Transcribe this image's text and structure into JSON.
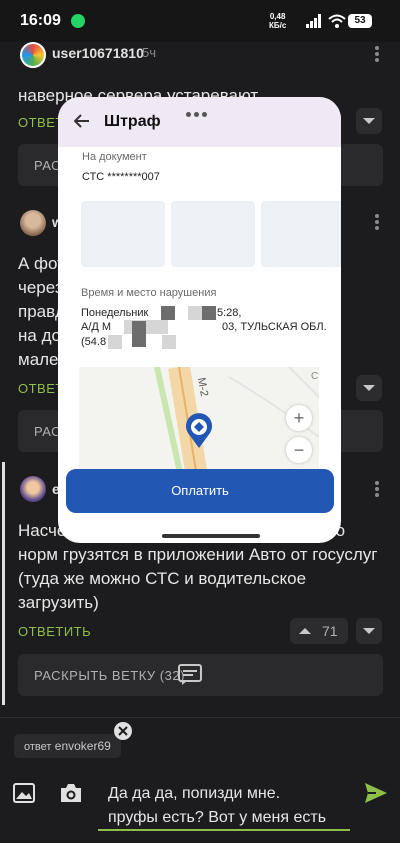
{
  "status_bar": {
    "time": "16:09",
    "speed_line1": "0,48",
    "speed_line2": "КБ/с",
    "battery": "53"
  },
  "comments": [
    {
      "username": "user10671810",
      "time": "5ч",
      "text": "наверное сервера устаревают",
      "reply_label": "ОТВЕТИТЬ",
      "expand_label": "РАСК"
    },
    {
      "username": "w",
      "text": "А фото\nчерез\nправд\nна до\nмале",
      "reply_label": "ОТВЕТ",
      "expand_label": "РАСК"
    },
    {
      "username": "e",
      "text": "Насче                                    е грузятся, но норм грузятся в приложении Авто от госуслуг (туда же можно СТС и водительское загрузить)",
      "reply_label": "ОТВЕТИТЬ",
      "votes": "71",
      "expand_label": "РАСКРЫТЬ ВЕТКУ (32)"
    }
  ],
  "modal": {
    "title": "Штраф",
    "document_label": "На документ",
    "document_value": "СТС ********007",
    "time_place_label": "Время и место нарушения",
    "line1_a": "Понедельник",
    "line1_b": "5:28,",
    "line2_a": "А/Д М",
    "line2_b": "03, ТУЛЬСКАЯ ОБЛ.",
    "line3_a": "(54.8",
    "map_road_label": "М-2",
    "map_corner_label": "С",
    "zoom_in": "+",
    "zoom_out": "−",
    "pay_button": "Оплатить"
  },
  "compose": {
    "reply_chip_prefix": "ответ",
    "reply_chip_user": "envoker69",
    "input_line1": "Да да да, попизди мне.",
    "input_line2": "пруфы есть? Вот у меня есть"
  },
  "colors": {
    "background": "#1c1c1e",
    "accent_green": "#8fbf4a",
    "pay_blue": "#2357b4",
    "map_pin_blue": "#2357b4"
  }
}
